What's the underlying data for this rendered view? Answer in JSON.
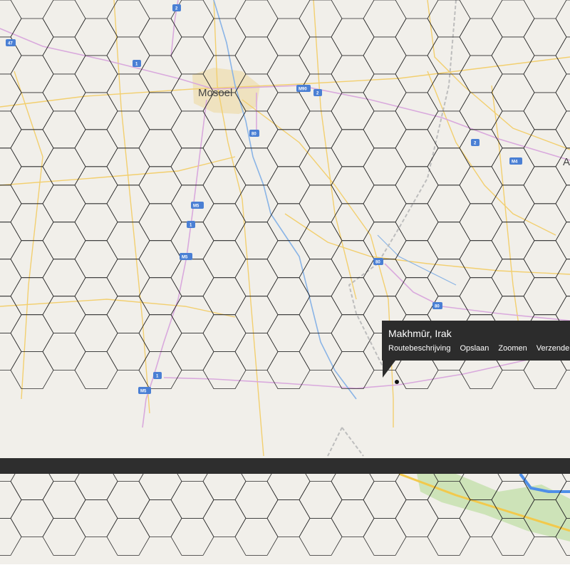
{
  "map": {
    "city_label": "Mosoel",
    "edge_label": "A",
    "road_shields": [
      {
        "label": "47",
        "color": "#4a7fd4"
      },
      {
        "label": "1",
        "color": "#4a7fd4"
      },
      {
        "label": "2",
        "color": "#4a7fd4"
      },
      {
        "label": "M90",
        "color": "#4a7fd4"
      },
      {
        "label": "80",
        "color": "#4a7fd4"
      },
      {
        "label": "M5",
        "color": "#4a7fd4"
      },
      {
        "label": "M4",
        "color": "#4a7fd4"
      }
    ],
    "colors": {
      "background": "#f1efea",
      "road_major": "#f2cf6f",
      "road_highway": "#d9a9dd",
      "river": "#8ab4e6",
      "park": "#cde3b8",
      "hex_grid": "#2a2a2a",
      "urban": "#efd89a"
    }
  },
  "popup": {
    "title": "Makhmūr, Irak",
    "actions": [
      "Routebeschrijving",
      "Opslaan",
      "Zoomen",
      "Verzenden"
    ]
  }
}
